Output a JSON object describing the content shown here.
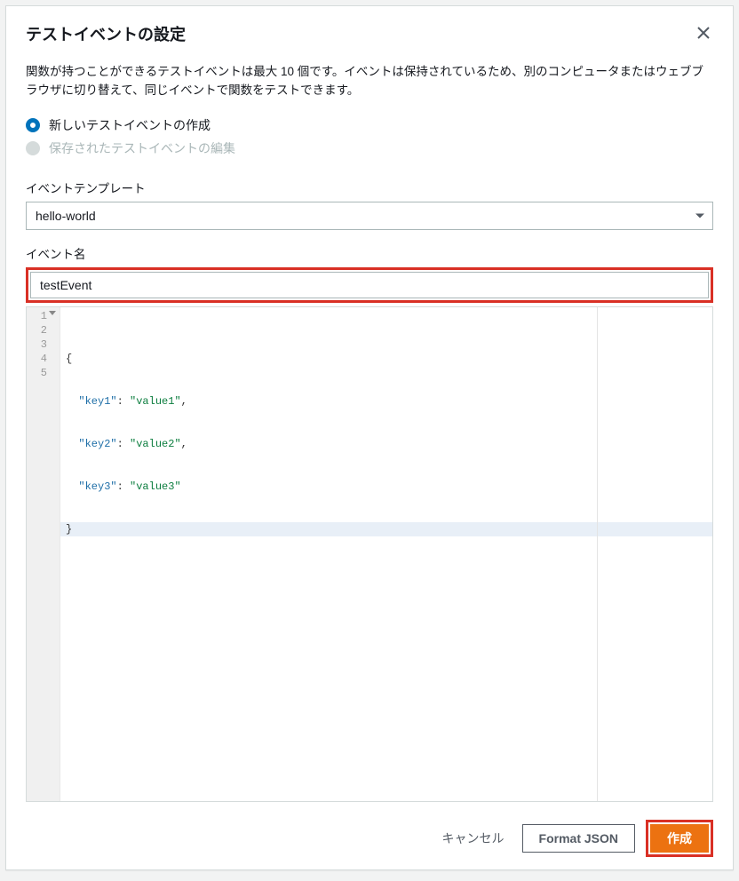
{
  "modal": {
    "title": "テストイベントの設定",
    "description": "関数が持つことができるテストイベントは最大 10 個です。イベントは保持されているため、別のコンピュータまたはウェブブラウザに切り替えて、同じイベントで関数をテストできます。"
  },
  "radios": {
    "create_label": "新しいテストイベントの作成",
    "edit_label": "保存されたテストイベントの編集"
  },
  "template_field": {
    "label": "イベントテンプレート",
    "value": "hello-world"
  },
  "name_field": {
    "label": "イベント名",
    "value": "testEvent"
  },
  "editor": {
    "line1": "{",
    "line2_key": "\"key1\"",
    "line2_sep": ": ",
    "line2_val": "\"value1\"",
    "line2_end": ",",
    "line3_key": "\"key2\"",
    "line3_sep": ": ",
    "line3_val": "\"value2\"",
    "line3_end": ",",
    "line4_key": "\"key3\"",
    "line4_sep": ": ",
    "line4_val": "\"value3\"",
    "line5": "}",
    "ln1": "1",
    "ln2": "2",
    "ln3": "3",
    "ln4": "4",
    "ln5": "5"
  },
  "footer": {
    "cancel": "キャンセル",
    "format": "Format JSON",
    "create": "作成"
  }
}
